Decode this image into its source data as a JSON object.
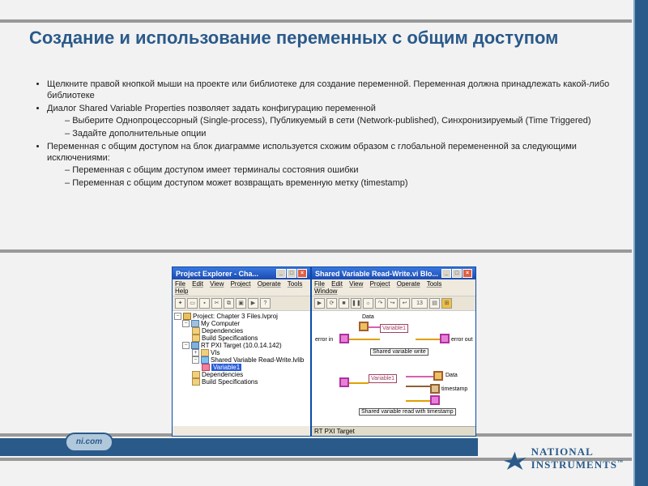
{
  "title": "Создание и использование переменных с общим доступом",
  "bullets": {
    "b1": "Щелкните правой кнопкой мыши на проекте или библиотеке для создание переменной. Переменная должна принадлежать какой-либо библиотеке",
    "b2": "Диалог Shared Variable Properties позволяет задать конфигурацию переменной",
    "b2a": "Выберите Однопроцессорный (Single-process), Публикуемый в сети (Network-published), Синхронизируемый (Time Triggered)",
    "b2b": "Задайте дополнительные опции",
    "b3": "Переменная с общим доступом на блок диаграмме используется схожим образом с глобальной перемененной за следующими исключениями:",
    "b3a": "Переменная с общим доступом имеет терминалы состояния ошибки",
    "b3b": "Переменная с общим доступом может возвращать временную метку (timestamp)"
  },
  "badge": "ni.com",
  "logo": {
    "line1": "NATIONAL",
    "line2": "INSTRUMENTS",
    "tm": "™"
  },
  "pe": {
    "title": "Project Explorer - Cha...",
    "menu": {
      "file": "File",
      "edit": "Edit",
      "view": "View",
      "project": "Project",
      "operate": "Operate",
      "tools": "Tools",
      "help": "Help"
    },
    "tree": {
      "root": "Project: Chapter 3 Files.lvproj",
      "mycomp": "My Computer",
      "deps1": "Dependencies",
      "build1": "Build Specifications",
      "target": "RT PXI Target (10.0.14.142)",
      "vis": "VIs",
      "svrw": "Shared Variable Read-Write.lvlib",
      "var": "Variable1",
      "deps2": "Dependencies",
      "build2": "Build Specifications"
    }
  },
  "bd": {
    "title": "Shared Variable Read-Write.vi Blo...",
    "menu": {
      "file": "File",
      "edit": "Edit",
      "view": "View",
      "project": "Project",
      "operate": "Operate",
      "tools": "Tools",
      "window": "Window"
    },
    "font": "13",
    "labels": {
      "data_in": "Data",
      "error_in": "error in",
      "var1": "Variable1",
      "error_out": "error out",
      "sv_write": "Shared variable write",
      "data_out": "Data",
      "var2": "Variable1",
      "timestamp": "timestamp",
      "sv_read": "Shared variable read with timestamp"
    },
    "status": "RT PXI Target"
  }
}
